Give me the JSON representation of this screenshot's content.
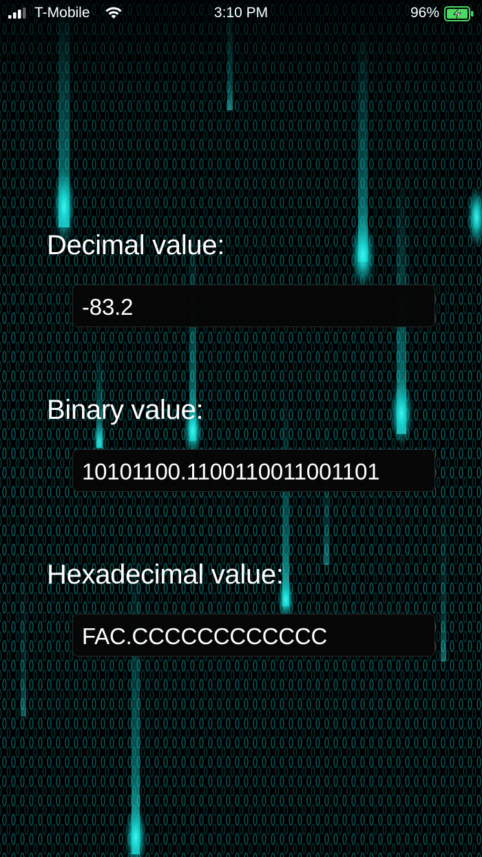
{
  "status_bar": {
    "carrier": "T-Mobile",
    "time": "3:10 PM",
    "battery_percent": "96%",
    "signal_icon": "cellular-signal-icon",
    "wifi_icon": "wifi-icon",
    "battery_icon": "battery-charging-icon"
  },
  "fields": {
    "decimal": {
      "label": "Decimal value:",
      "value": "-83.2"
    },
    "binary": {
      "label": "Binary value:",
      "value": "10101100.1100110011001101"
    },
    "hex": {
      "label": "Hexadecimal value:",
      "value": "FAC.CCCCCCCCCCCC"
    }
  },
  "theme": {
    "background": "#000000",
    "accent_cyan": "#19e6e0",
    "battery_green": "#4cd964",
    "field_background": "#060606"
  }
}
